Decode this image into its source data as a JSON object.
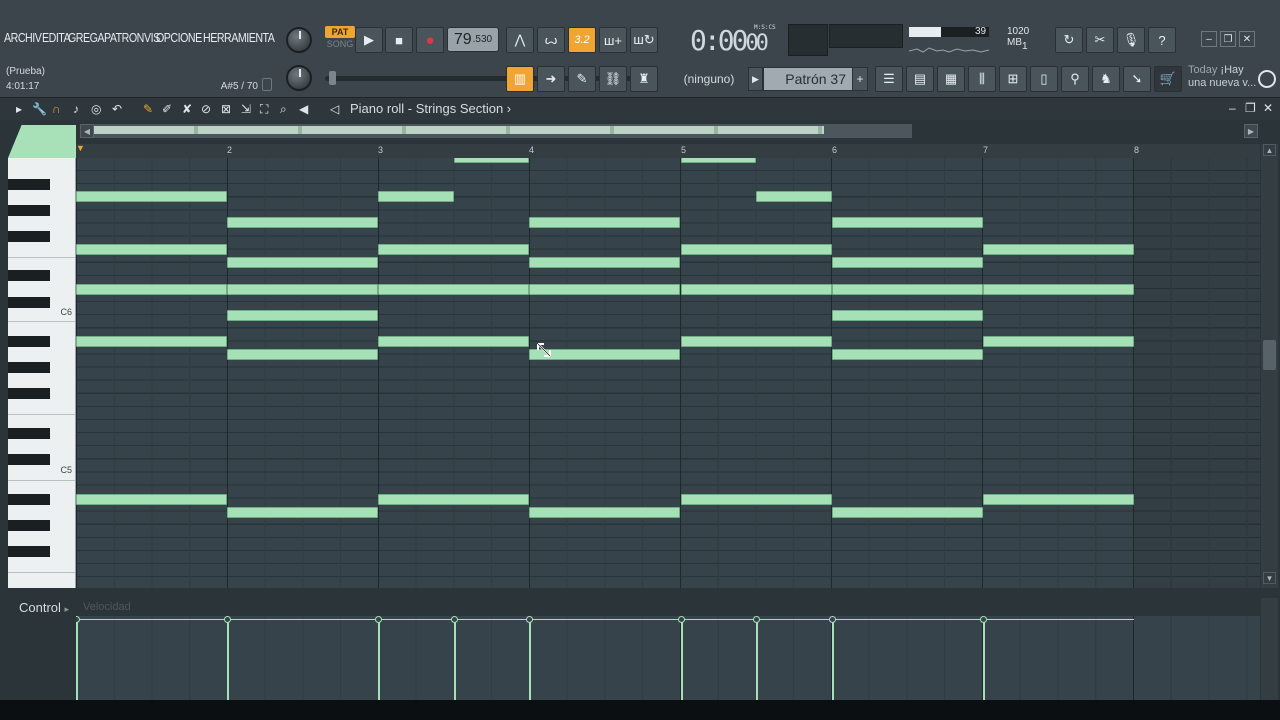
{
  "menu": [
    "ARCHIV",
    "EDITA",
    "GREGA",
    "PATRON",
    "VIS",
    "OPCIONE",
    "HERRAMIENTA"
  ],
  "hint": {
    "project": "(Prueba)",
    "time": "4:01:17",
    "note_info": "A#5 / 70"
  },
  "transport": {
    "pat_label": "PAT",
    "song_label": "SONG",
    "tempo_main": "79",
    "tempo_decimal": ".530"
  },
  "snap_value": "3.2",
  "time_display": {
    "main": "0:00",
    "sub": "00",
    "format": "M:S:CS"
  },
  "cpu": {
    "value": "39",
    "memory": "1020 MB",
    "poly": "1"
  },
  "toolbar2": {
    "preset": "(ninguno)",
    "pattern": "Patrón 37",
    "plus": "+"
  },
  "news": {
    "today": "Today",
    "line1": "¡Hay",
    "line2": "una nueva v..."
  },
  "piano_roll": {
    "title": "Piano roll - Strings Section",
    "bars": [
      "2",
      "3",
      "4",
      "5",
      "6",
      "7",
      "8"
    ],
    "key_labels": [
      "C6",
      "C5"
    ]
  },
  "control": {
    "label": "Control",
    "target": "Velocidad"
  },
  "colors": {
    "note": "#a6e0b6",
    "accent": "#f0a431",
    "grid_bg": "#37434a"
  }
}
